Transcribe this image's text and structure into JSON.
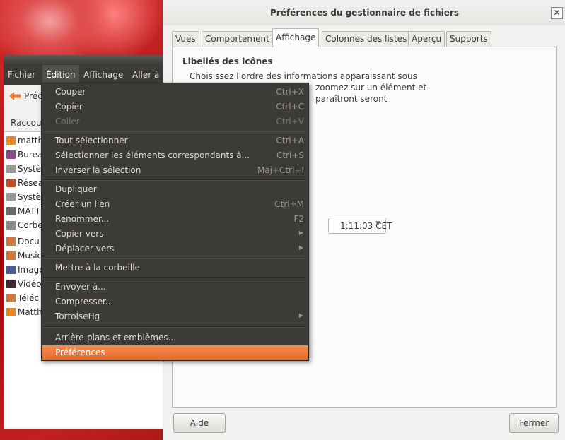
{
  "file_manager": {
    "menubar": [
      "Fichier",
      "Édition",
      "Affichage",
      "Aller à"
    ],
    "back_label": "Préc",
    "sidebar_header": "Raccou",
    "sidebar_items": [
      {
        "label": "matth",
        "icon": "home-folder-icon",
        "color": "#e48a2a"
      },
      {
        "label": "Burea",
        "icon": "desktop-icon",
        "color": "#8a4a8a"
      },
      {
        "label": "Systè",
        "icon": "drive-icon",
        "color": "#8a8a8a"
      },
      {
        "label": "Résea",
        "icon": "network-icon",
        "color": "#c04a2a"
      },
      {
        "label": "Systè",
        "icon": "drive-icon",
        "color": "#8a8a8a"
      },
      {
        "label": "MATT",
        "icon": "usb-drive-icon",
        "color": "#6a6a6a"
      },
      {
        "label": "Corbe",
        "icon": "trash-icon",
        "color": "#7a7a7a"
      },
      {
        "label": "Docu",
        "icon": "documents-folder-icon",
        "color": "#d07a3a"
      },
      {
        "label": "Music",
        "icon": "music-folder-icon",
        "color": "#d07a3a"
      },
      {
        "label": "Image",
        "icon": "pictures-folder-icon",
        "color": "#4a5a8a"
      },
      {
        "label": "Vidéo",
        "icon": "videos-folder-icon",
        "color": "#3a2a2a"
      },
      {
        "label": "Téléc",
        "icon": "downloads-folder-icon",
        "color": "#d07a3a"
      },
      {
        "label": "Matth",
        "icon": "folder-icon",
        "color": "#e48a2a"
      }
    ]
  },
  "dialog": {
    "title": "Préférences du gestionnaire de fichiers",
    "close": "✕",
    "tabs": [
      {
        "label": "Vues",
        "active": false
      },
      {
        "label": "Comportement",
        "active": false
      },
      {
        "label": "Affichage",
        "active": true
      },
      {
        "label": "Colonnes des listes",
        "active": false
      },
      {
        "label": "Aperçu",
        "active": false
      },
      {
        "label": "Supports",
        "active": false
      }
    ],
    "section_title": "Libellés des icônes",
    "desc_line1": "Choisissez l'ordre des informations apparaissant sous",
    "desc_line2": "zoomez sur un élément et",
    "desc_line3": "paraîtront seront",
    "date_format_visible": "1:11:03 CET",
    "help_button": "Aide",
    "close_button": "Fermer"
  },
  "edit_menu": {
    "items": [
      {
        "label": "Couper",
        "accel": "Ctrl+X"
      },
      {
        "label": "Copier",
        "accel": "Ctrl+C"
      },
      {
        "label": "Coller",
        "accel": "Ctrl+V",
        "disabled": true
      },
      {
        "label": "Tout sélectionner",
        "accel": "Ctrl+A"
      },
      {
        "label": "Sélectionner les éléments correspondants à...",
        "accel": "Ctrl+S"
      },
      {
        "label": "Inverser la sélection",
        "accel": "Maj+Ctrl+I"
      },
      {
        "label": "Dupliquer",
        "accel": ""
      },
      {
        "label": "Créer un lien",
        "accel": "Ctrl+M"
      },
      {
        "label": "Renommer...",
        "accel": "F2"
      },
      {
        "label": "Copier vers",
        "submenu": true
      },
      {
        "label": "Déplacer vers",
        "submenu": true
      },
      {
        "label": "Mettre à la corbeille",
        "accel": ""
      },
      {
        "label": "Envoyer à...",
        "accel": ""
      },
      {
        "label": "Compresser...",
        "accel": ""
      },
      {
        "label": "TortoiseHg",
        "submenu": true
      },
      {
        "label": "Arrière-plans et emblèmes...",
        "accel": ""
      },
      {
        "label": "Préférences",
        "accel": "",
        "selected": true
      }
    ]
  }
}
